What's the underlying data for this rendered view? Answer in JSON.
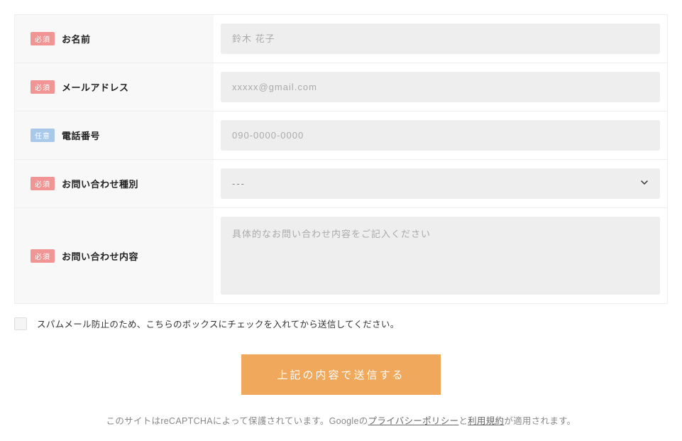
{
  "badges": {
    "required": "必須",
    "optional": "任意"
  },
  "fields": {
    "name": {
      "label": "お名前",
      "placeholder": "鈴木 花子"
    },
    "email": {
      "label": "メールアドレス",
      "placeholder": "xxxxx@gmail.com"
    },
    "phone": {
      "label": "電話番号",
      "placeholder": "090-0000-0000"
    },
    "type": {
      "label": "お問い合わせ種別",
      "selected": "---"
    },
    "content": {
      "label": "お問い合わせ内容",
      "placeholder": "具体的なお問い合わせ内容をご記入ください"
    }
  },
  "checkbox": {
    "label": "スパムメール防止のため、こちらのボックスにチェックを入れてから送信してください。"
  },
  "submit": {
    "label": "上記の内容で送信する"
  },
  "disclaimer": {
    "part1": "このサイトはreCAPTCHAによって保護されています。Googleの",
    "link1": "プライバシーポリシー",
    "part2": "と",
    "link2": "利用規約",
    "part3": "が適用されます。"
  }
}
